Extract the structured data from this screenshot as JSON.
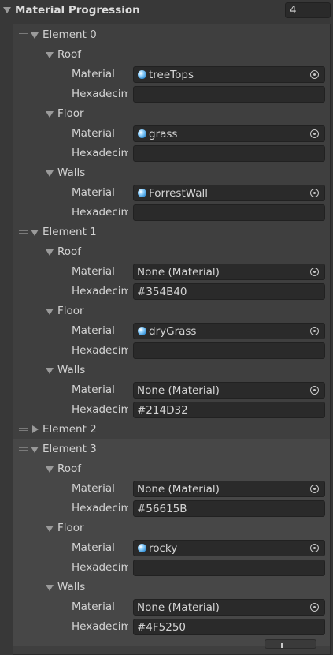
{
  "header": {
    "title": "Material Progression",
    "count": "4"
  },
  "elements": [
    {
      "label": "Element 0",
      "expanded": true,
      "sections": [
        {
          "name": "Roof",
          "material": "treeTops",
          "material_has_icon": true,
          "hex": ""
        },
        {
          "name": "Floor",
          "material": "grass",
          "material_has_icon": true,
          "hex": ""
        },
        {
          "name": "Walls",
          "material": "ForrestWall",
          "material_has_icon": true,
          "hex": ""
        }
      ]
    },
    {
      "label": "Element 1",
      "expanded": true,
      "sections": [
        {
          "name": "Roof",
          "material": "None (Material)",
          "material_has_icon": false,
          "hex": "#354B40"
        },
        {
          "name": "Floor",
          "material": "dryGrass",
          "material_has_icon": true,
          "hex": ""
        },
        {
          "name": "Walls",
          "material": "None (Material)",
          "material_has_icon": false,
          "hex": "#214D32"
        }
      ]
    },
    {
      "label": "Element 2",
      "expanded": false,
      "sections": []
    },
    {
      "label": "Element 3",
      "expanded": true,
      "selected": true,
      "sections": [
        {
          "name": "Roof",
          "material": "None (Material)",
          "material_has_icon": false,
          "hex": "#56615B"
        },
        {
          "name": "Floor",
          "material": "rocky",
          "material_has_icon": true,
          "hex": ""
        },
        {
          "name": "Walls",
          "material": "None (Material)",
          "material_has_icon": false,
          "hex": "#4F5250"
        }
      ]
    }
  ],
  "labels": {
    "material": "Material",
    "hex": "Hexadecimal"
  },
  "colors": {
    "background": "#383838",
    "field": "#2a2a2a",
    "selected": "#474747",
    "text": "#d2d2d2"
  }
}
